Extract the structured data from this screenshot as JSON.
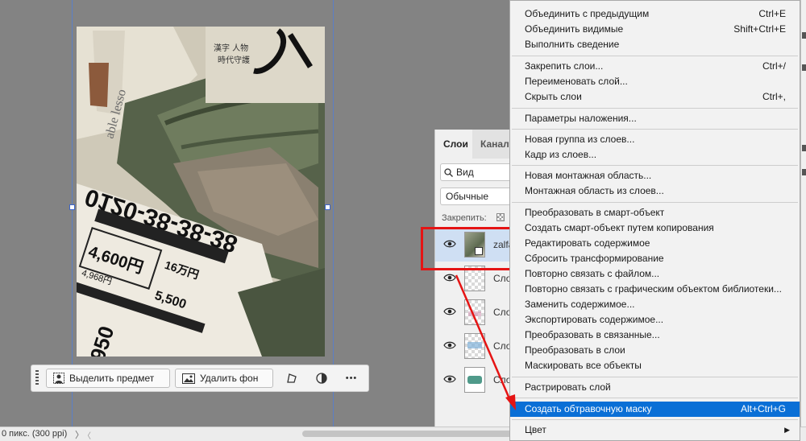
{
  "toolbar": {
    "select_subject_label": "Выделить предмет",
    "remove_bg_label": "Удалить фон",
    "more_label": "•••"
  },
  "status": {
    "resolution_text": "0 пикс. (300 ppi)",
    "arrow": "〉",
    "scroll_left": "〈"
  },
  "layers_panel": {
    "tabs": [
      "Слои",
      "Каналы"
    ],
    "filter_label": "Вид",
    "blend_mode": "Обычные",
    "lock_label": "Закрепить:",
    "layers": [
      {
        "name": "zalfa",
        "selected": true
      },
      {
        "name": "Слой",
        "selected": false
      },
      {
        "name": "Слой",
        "selected": false
      },
      {
        "name": "Слой",
        "selected": false
      },
      {
        "name": "Слой",
        "selected": false
      }
    ]
  },
  "context_menu": {
    "items": [
      {
        "label": "Объединить с предыдущим",
        "shortcut": "Ctrl+E"
      },
      {
        "label": "Объединить видимые",
        "shortcut": "Shift+Ctrl+E"
      },
      {
        "label": "Выполнить сведение",
        "shortcut": ""
      },
      {
        "label": "Закрепить слои...",
        "shortcut": "Ctrl+/"
      },
      {
        "label": "Переименовать слой...",
        "shortcut": ""
      },
      {
        "label": "Скрыть слои",
        "shortcut": "Ctrl+,"
      },
      {
        "label": "Параметры наложения...",
        "shortcut": ""
      },
      {
        "label": "Новая группа из слоев...",
        "shortcut": ""
      },
      {
        "label": "Кадр из слоев...",
        "shortcut": ""
      },
      {
        "label": "Новая монтажная область...",
        "shortcut": ""
      },
      {
        "label": "Монтажная область из слоев...",
        "shortcut": ""
      },
      {
        "label": "Преобразовать в смарт-объект",
        "shortcut": ""
      },
      {
        "label": "Создать смарт-объект путем копирования",
        "shortcut": ""
      },
      {
        "label": "Редактировать содержимое",
        "shortcut": ""
      },
      {
        "label": "Сбросить трансформирование",
        "shortcut": ""
      },
      {
        "label": "Повторно связать с файлом...",
        "shortcut": ""
      },
      {
        "label": "Повторно связать с графическим объектом библиотеки...",
        "shortcut": ""
      },
      {
        "label": "Заменить содержимое...",
        "shortcut": ""
      },
      {
        "label": "Экспортировать содержимое...",
        "shortcut": ""
      },
      {
        "label": "Преобразовать в связанные...",
        "shortcut": ""
      },
      {
        "label": "Преобразовать в слои",
        "shortcut": ""
      },
      {
        "label": "Маскировать все объекты",
        "shortcut": ""
      },
      {
        "label": "Растрировать слой",
        "shortcut": ""
      },
      {
        "label": "Создать обтравочную маску",
        "shortcut": "Alt+Ctrl+G",
        "highlighted": true
      },
      {
        "label": "Цвет",
        "shortcut": "",
        "submenu": true
      }
    ]
  },
  "artwork": {
    "phone_number": "0120-38-38-38",
    "price_1": "4,600円",
    "price_2": "4,968円",
    "price_3": "16万円",
    "partial_text": "able lesso",
    "price_4": "950",
    "price_5": "5,500"
  },
  "colors": {
    "accent": "#0a6fd6",
    "highlight_red": "#e51414",
    "guide_blue": "#5b7fc7"
  }
}
